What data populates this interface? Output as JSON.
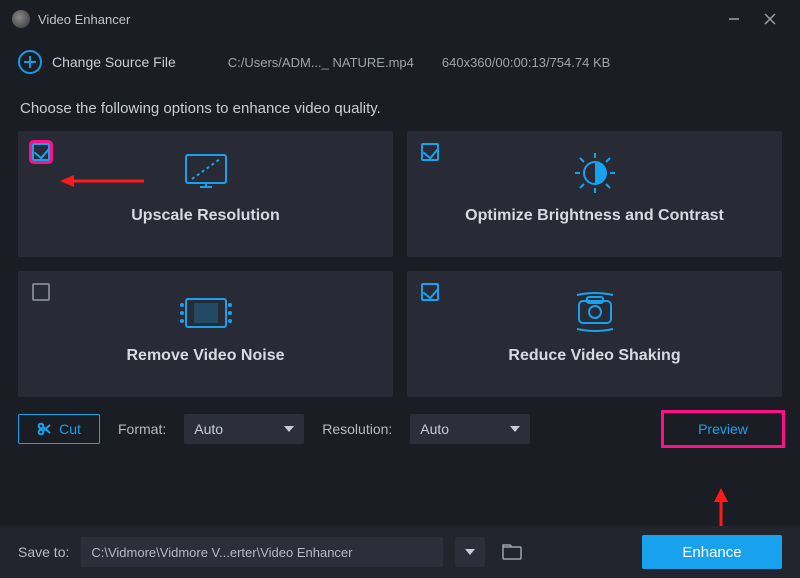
{
  "titlebar": {
    "title": "Video Enhancer"
  },
  "source": {
    "change_label": "Change Source File",
    "path": "C:/Users/ADM..._ NATURE.mp4",
    "meta": "640x360/00:00:13/754.74 KB"
  },
  "instruction": "Choose the following options to enhance video quality.",
  "options": {
    "upscale": {
      "label": "Upscale Resolution",
      "checked": true
    },
    "brightness": {
      "label": "Optimize Brightness and Contrast",
      "checked": true
    },
    "noise": {
      "label": "Remove Video Noise",
      "checked": false
    },
    "shaking": {
      "label": "Reduce Video Shaking",
      "checked": true
    }
  },
  "controls": {
    "cut_label": "Cut",
    "format_label": "Format:",
    "format_value": "Auto",
    "resolution_label": "Resolution:",
    "resolution_value": "Auto",
    "preview_label": "Preview"
  },
  "footer": {
    "save_label": "Save to:",
    "save_path": "C:\\Vidmore\\Vidmore V...erter\\Video Enhancer",
    "enhance_label": "Enhance"
  }
}
